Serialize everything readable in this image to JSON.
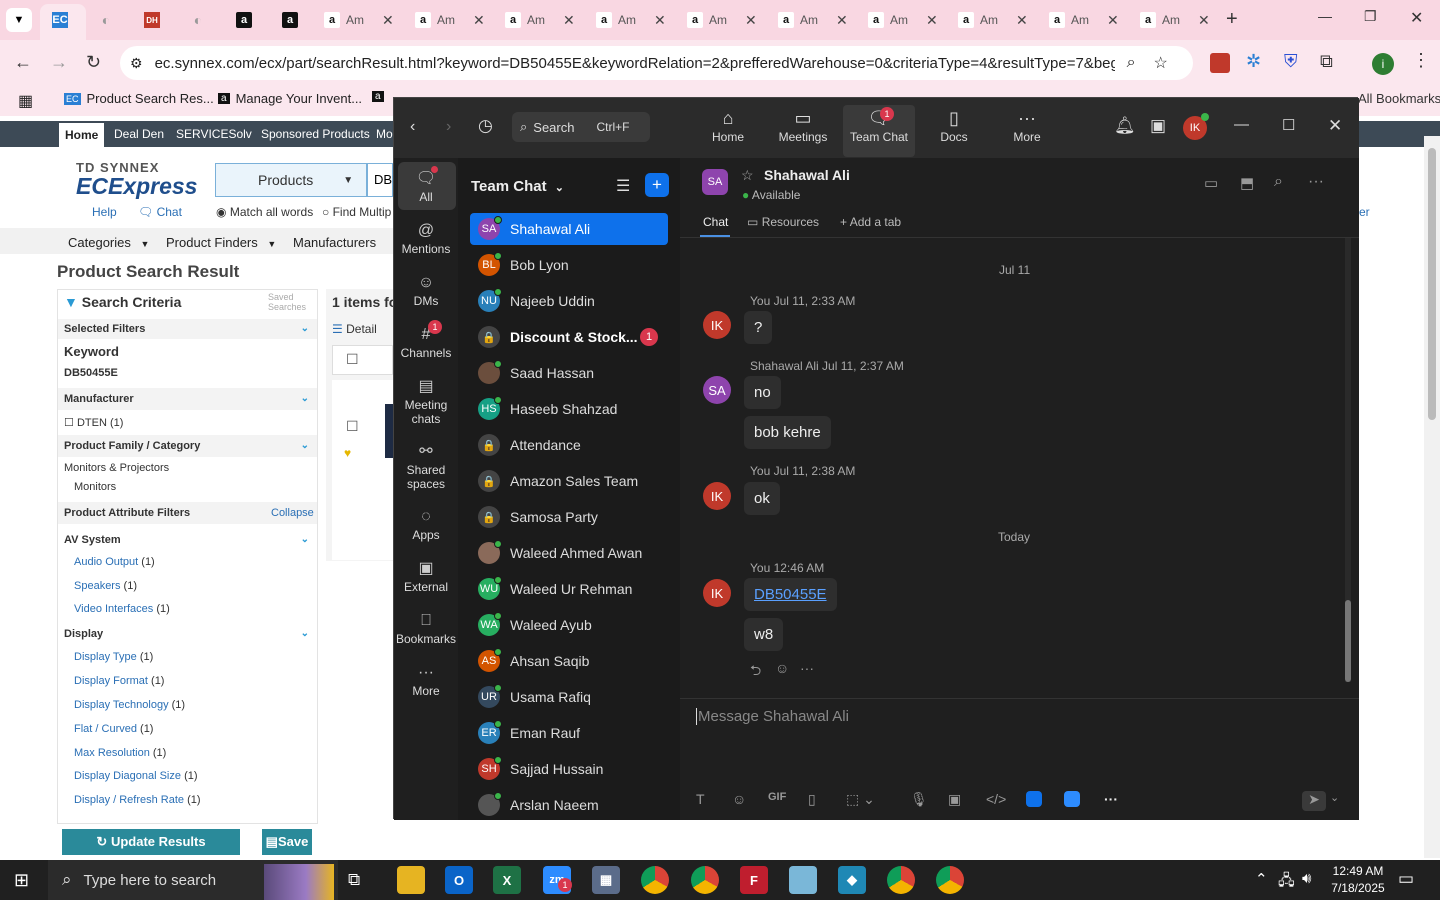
{
  "browser": {
    "tabs": [
      {
        "label": "Am"
      },
      {
        "label": "Am"
      },
      {
        "label": "Am"
      },
      {
        "label": "Am"
      },
      {
        "label": "Am"
      },
      {
        "label": "Am"
      },
      {
        "label": "Am"
      },
      {
        "label": "Am"
      },
      {
        "label": "Am"
      },
      {
        "label": "Am"
      }
    ],
    "url": "ec.synnex.com/ecx/part/searchResult.html?keyword=DB50455E&keywordRelation=2&prefferedWarehouse=0&criteriaType=4&resultType=7&begin=0&c...",
    "bookmarks": [
      "Product Search Res...",
      "Manage Your Invent..."
    ],
    "all_bookmarks": "All Bookmarks"
  },
  "site": {
    "nav": [
      "Home",
      "Deal Den",
      "SERVICESolv",
      "Sponsored Products",
      "Mo"
    ],
    "logo_top": "TD SYNNEX",
    "logo": "ECExpress",
    "products_select": "Products",
    "search_prefix": "DB5",
    "help": "Help",
    "chat": "Chat",
    "match_all": "Match all words",
    "find_multiple": "Find Multip",
    "menu": [
      "Categories",
      "Product Finders",
      "Manufacturers"
    ],
    "page_title": "Product Search Result",
    "search_criteria": "Search Criteria",
    "saved_searches": "Saved Searches",
    "items_found": "1 items fo",
    "detail": "Detail",
    "selected_filters": "Selected Filters",
    "keyword_label": "Keyword",
    "keyword_value": "DB50455E",
    "manufacturer": "Manufacturer",
    "manufacturer_item": "DTEN (1)",
    "family": "Product Family / Category",
    "family_1": "Monitors & Projectors",
    "family_2": "Monitors",
    "attr_filters": "Product Attribute Filters",
    "collapse": "Collapse",
    "av_system": "AV System",
    "av_items": [
      "Audio Output",
      "Speakers",
      "Video Interfaces"
    ],
    "display": "Display",
    "display_items": [
      "Display Type",
      "Display Format",
      "Display Technology",
      "Flat / Curved",
      "Max Resolution",
      "Display Diagonal Size",
      "Display / Refresh Rate"
    ],
    "count": "(1)",
    "update": "Update Results",
    "save": "Save",
    "right_edge": "er"
  },
  "teams": {
    "search": "Search",
    "shortcut": "Ctrl+F",
    "top": [
      {
        "label": "Home"
      },
      {
        "label": "Meetings"
      },
      {
        "label": "Team Chat",
        "badge": "1"
      },
      {
        "label": "Docs"
      },
      {
        "label": "More"
      }
    ],
    "user_initials": "IK",
    "rail": [
      {
        "label": "All"
      },
      {
        "label": "Mentions"
      },
      {
        "label": "DMs"
      },
      {
        "label": "Channels",
        "badge": "1"
      },
      {
        "label": "Meeting chats"
      },
      {
        "label": "Shared spaces"
      },
      {
        "label": "Apps"
      },
      {
        "label": "External"
      },
      {
        "label": "Bookmarks"
      },
      {
        "label": "More"
      }
    ],
    "list_title": "Team Chat",
    "contacts": [
      {
        "i": "SA",
        "name": "Shahawal Ali",
        "color": "#8e44ad"
      },
      {
        "i": "BL",
        "name": "Bob Lyon",
        "color": "#d35400"
      },
      {
        "i": "NU",
        "name": "Najeeb Uddin",
        "color": "#2980b9"
      },
      {
        "i": "🔒",
        "name": "Discount & Stock...",
        "color": "#444",
        "badge": "1"
      },
      {
        "i": "",
        "name": "Saad Hassan",
        "color": "#6b4e3d"
      },
      {
        "i": "HS",
        "name": "Haseeb Shahzad",
        "color": "#16a085"
      },
      {
        "i": "🔒",
        "name": "Attendance",
        "color": "#444"
      },
      {
        "i": "🔒",
        "name": "Amazon Sales Team",
        "color": "#444"
      },
      {
        "i": "🔒",
        "name": "Samosa Party",
        "color": "#444"
      },
      {
        "i": "",
        "name": "Waleed Ahmed Awan",
        "color": "#8a6a5a"
      },
      {
        "i": "WU",
        "name": "Waleed Ur Rehman",
        "color": "#27ae60"
      },
      {
        "i": "WA",
        "name": "Waleed Ayub",
        "color": "#27ae60"
      },
      {
        "i": "AS",
        "name": "Ahsan Saqib",
        "color": "#d35400"
      },
      {
        "i": "UR",
        "name": "Usama Rafiq",
        "color": "#34495e"
      },
      {
        "i": "ER",
        "name": "Eman Rauf",
        "color": "#2980b9"
      },
      {
        "i": "SH",
        "name": "Sajjad Hussain",
        "color": "#c0392b"
      },
      {
        "i": "",
        "name": "Arslan Naeem",
        "color": "#555"
      }
    ],
    "chat_name": "Shahawal Ali",
    "chat_initials": "SA",
    "status": "Available",
    "tabs": [
      "Chat",
      "Resources",
      "Add a tab"
    ],
    "date1": "Jul 11",
    "date2": "Today",
    "m1_meta": "You Jul 11, 2:33 AM",
    "m1": "?",
    "m2_meta": "Shahawal Ali Jul 11, 2:37 AM",
    "m2a": "no",
    "m2b": "bob kehre",
    "m3_meta": "You Jul 11, 2:38 AM",
    "m3": "ok",
    "m4_meta": "You 12:46 AM",
    "m4a": "DB50455E",
    "m4b": "w8",
    "placeholder": "Message Shahawal Ali"
  },
  "taskbar": {
    "search": "Type here to search",
    "time": "12:49 AM",
    "date": "7/18/2025",
    "zoom_badge": "1"
  }
}
